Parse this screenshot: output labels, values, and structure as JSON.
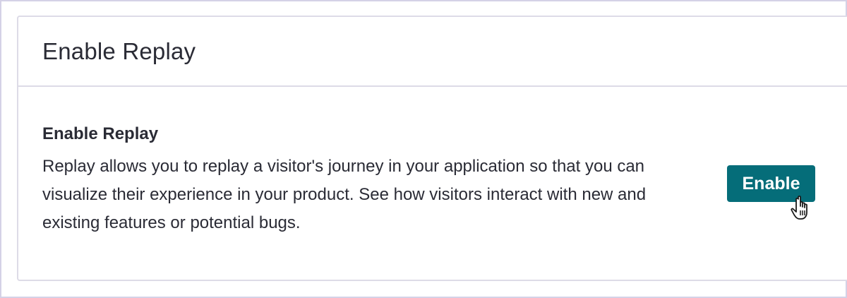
{
  "card": {
    "title": "Enable Replay"
  },
  "section": {
    "title": "Enable Replay",
    "description": "Replay allows you to replay a visitor's journey in your application so that you can visualize their experience in your product. See how visitors interact with new and existing features or potential bugs."
  },
  "actions": {
    "enable_label": "Enable"
  },
  "colors": {
    "button_bg": "#056d79",
    "text": "#2a2b35",
    "border": "#dddbe7"
  },
  "icons": {
    "cursor": "hand-pointer-icon"
  }
}
